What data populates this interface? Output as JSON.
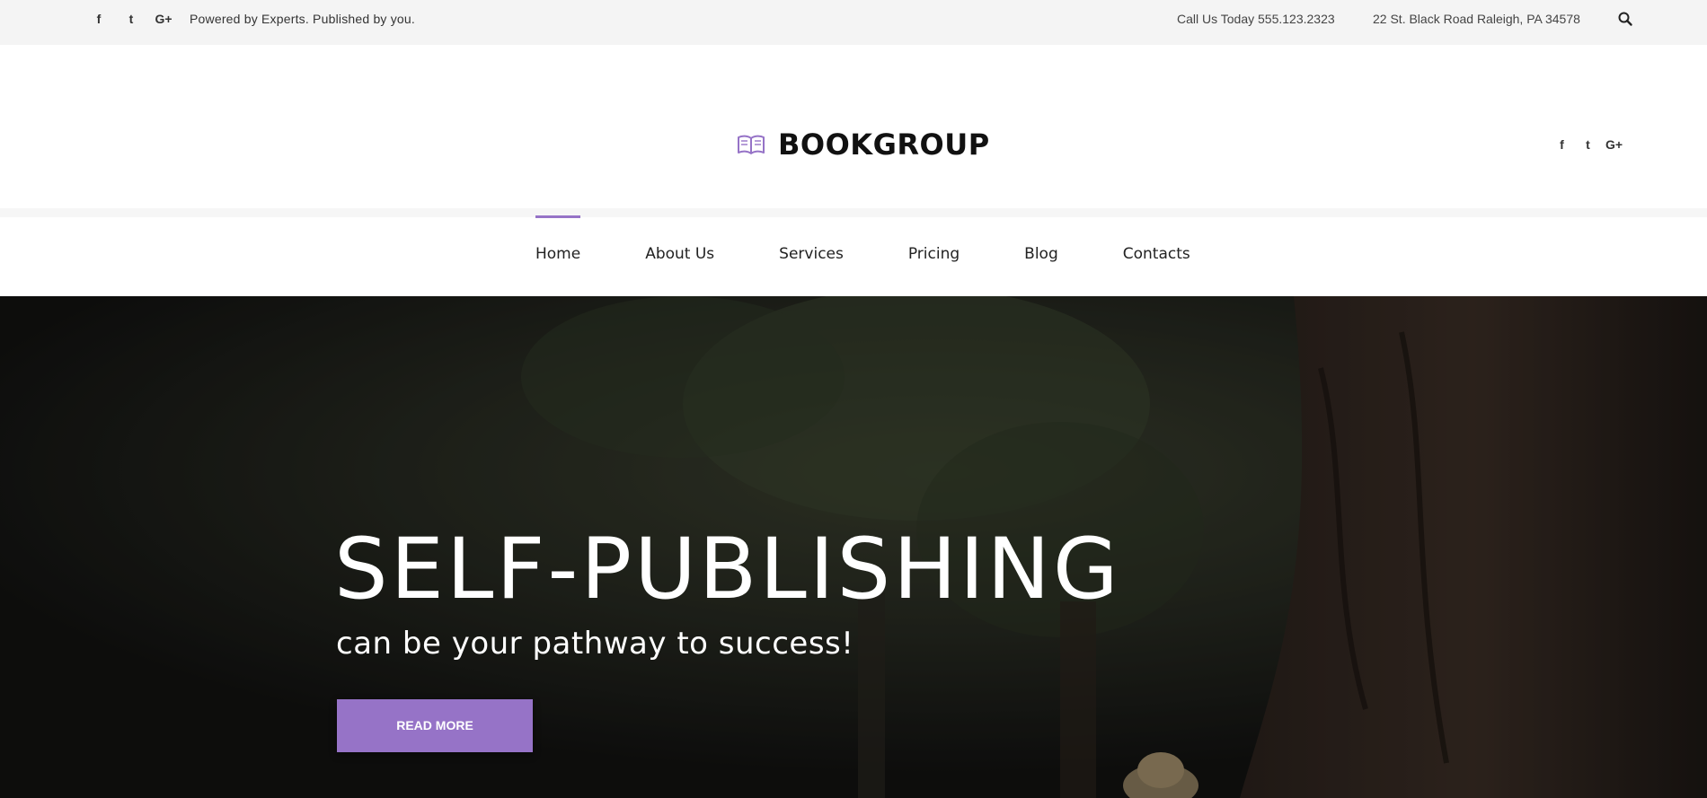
{
  "topbar": {
    "social": [
      "f",
      "t",
      "G+"
    ],
    "tagline": "Powered by Experts. Published by you.",
    "phone": "Call Us Today 555.123.2323",
    "address": "22 St. Black Road  Raleigh, PA 34578"
  },
  "header": {
    "brand": "BOOKGROUP",
    "social": [
      "f",
      "t",
      "G+"
    ]
  },
  "nav": {
    "items": [
      "Home",
      "About Us",
      "Services",
      "Pricing",
      "Blog",
      "Contacts"
    ],
    "active": "Home"
  },
  "hero": {
    "title": "SELF-PUBLISHING",
    "subtitle": "can be your pathway to success!",
    "button": "READ MORE"
  },
  "colors": {
    "accent": "#9673c7",
    "topbar_bg": "#f4f4f4"
  }
}
